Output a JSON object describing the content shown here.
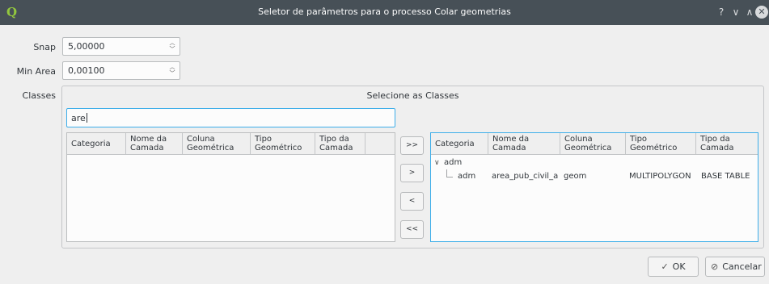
{
  "window": {
    "title": "Seletor de parâmetros para o processo Colar geometrias",
    "app_icon": "Q",
    "help": "?",
    "minimize": "∨",
    "maximize": "∧",
    "close": "✕"
  },
  "params": {
    "snap_label": "Snap",
    "snap_value": "5,00000",
    "min_area_label": "Min Area",
    "min_area_value": "0,00100",
    "classes_label": "Classes"
  },
  "selector": {
    "title": "Selecione as Classes",
    "filter_value": "are",
    "columns": [
      {
        "line1": "Categoria",
        "line2": ""
      },
      {
        "line1": "Nome da",
        "line2": "Camada"
      },
      {
        "line1": "Coluna",
        "line2": "Geométrica"
      },
      {
        "line1": "Tipo",
        "line2": "Geométrico"
      },
      {
        "line1": "Tipo da",
        "line2": "Camada"
      }
    ],
    "buttons": {
      "add_all": ">>",
      "add": ">",
      "remove": "<",
      "remove_all": "<<"
    },
    "selected": {
      "group": "adm",
      "expander": "∨",
      "rows": [
        {
          "categoria": "adm",
          "nome": "area_pub_civil_a",
          "coluna": "geom",
          "tipo_geom": "MULTIPOLYGON",
          "tipo_camada": "BASE TABLE"
        }
      ]
    }
  },
  "footer": {
    "ok_label": "OK",
    "ok_icon": "✓",
    "cancel_label": "Cancelar",
    "cancel_icon": "⊘"
  }
}
